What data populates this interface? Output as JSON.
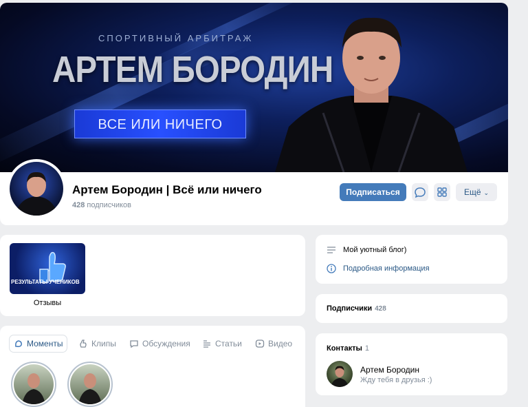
{
  "cover": {
    "subtitle": "СПОРТИВНЫЙ АРБИТРАЖ",
    "title": "АРТЕМ БОРОДИН",
    "banner": "ВСЕ ИЛИ НИЧЕГО"
  },
  "profile": {
    "name": "Артем Бородин | Всё или ничего",
    "subscribers_count": "428",
    "subscribers_label": "подписчиков"
  },
  "actions": {
    "subscribe": "Подписаться",
    "more": "Ещё"
  },
  "albums": [
    {
      "thumb_text": "РЕЗУЛЬТАТЫ УЧЕНИКОВ",
      "label": "Отзывы"
    }
  ],
  "tabs": [
    {
      "label": "Моменты",
      "icon": "moments-icon",
      "active": true
    },
    {
      "label": "Клипы",
      "icon": "clips-icon",
      "active": false
    },
    {
      "label": "Обсуждения",
      "icon": "discussions-icon",
      "active": false
    },
    {
      "label": "Статьи",
      "icon": "articles-icon",
      "active": false
    },
    {
      "label": "Видео",
      "icon": "video-icon",
      "active": false
    }
  ],
  "info": {
    "status": "Мой уютный блог)",
    "details_link": "Подробная информация"
  },
  "subscribers_block": {
    "title": "Подписчики",
    "count": "428"
  },
  "contacts": {
    "title": "Контакты",
    "count": "1",
    "items": [
      {
        "name": "Артем Бородин",
        "description": "Жду тебя в друзья :)"
      }
    ]
  },
  "colors": {
    "accent": "#447bba",
    "link": "#2a5885",
    "muted": "#818c99",
    "background": "#edeef0"
  }
}
